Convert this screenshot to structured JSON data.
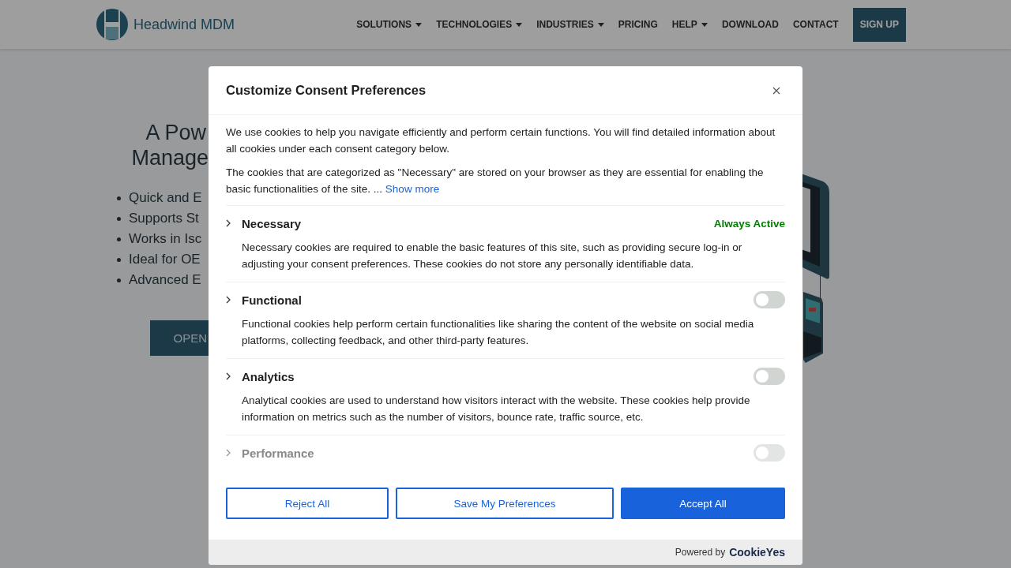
{
  "site": {
    "brand": "Headwind MDM",
    "nav": [
      {
        "label": "SOLUTIONS",
        "dropdown": true
      },
      {
        "label": "TECHNOLOGIES",
        "dropdown": true
      },
      {
        "label": "INDUSTRIES",
        "dropdown": true
      },
      {
        "label": "PRICING",
        "dropdown": false
      },
      {
        "label": "HELP",
        "dropdown": true
      },
      {
        "label": "DOWNLOAD",
        "dropdown": false
      },
      {
        "label": "CONTACT",
        "dropdown": false
      }
    ],
    "signup": "SIGN UP",
    "hero": {
      "heading_lines": [
        "A Pow",
        "Manage"
      ],
      "bullets": [
        "Quick and E",
        "Supports St",
        "Works in Isc",
        "Ideal for OE",
        "Advanced E"
      ],
      "button": "OPEN"
    }
  },
  "dialog": {
    "title": "Customize Consent Preferences",
    "intro": [
      "We use cookies to help you navigate efficiently and perform certain functions. You will find detailed information about all cookies under each consent category below.",
      "The cookies that are categorized as \"Necessary\" are stored on your browser as they are essential for enabling the basic functionalities of the site. ... "
    ],
    "show_more": "Show more",
    "categories": [
      {
        "name": "Necessary",
        "kind": "always_active",
        "status": "Always Active",
        "description": "Necessary cookies are required to enable the basic features of this site, such as providing secure log-in or adjusting your consent preferences. These cookies do not store any personally identifiable data."
      },
      {
        "name": "Functional",
        "kind": "toggle",
        "on": false,
        "description": "Functional cookies help perform certain functionalities like sharing the content of the website on social media platforms, collecting feedback, and other third-party features."
      },
      {
        "name": "Analytics",
        "kind": "toggle",
        "on": false,
        "description": "Analytical cookies are used to understand how visitors interact with the website. These cookies help provide information on metrics such as the number of visitors, bounce rate, traffic source, etc."
      },
      {
        "name": "Performance",
        "kind": "toggle",
        "on": false
      }
    ],
    "buttons": [
      {
        "label": "Reject All",
        "kind": "outline"
      },
      {
        "label": "Save My Preferences",
        "kind": "outline"
      },
      {
        "label": "Accept All",
        "kind": "primary"
      }
    ],
    "powered_by": "Powered by",
    "brand": "CookieYes"
  }
}
